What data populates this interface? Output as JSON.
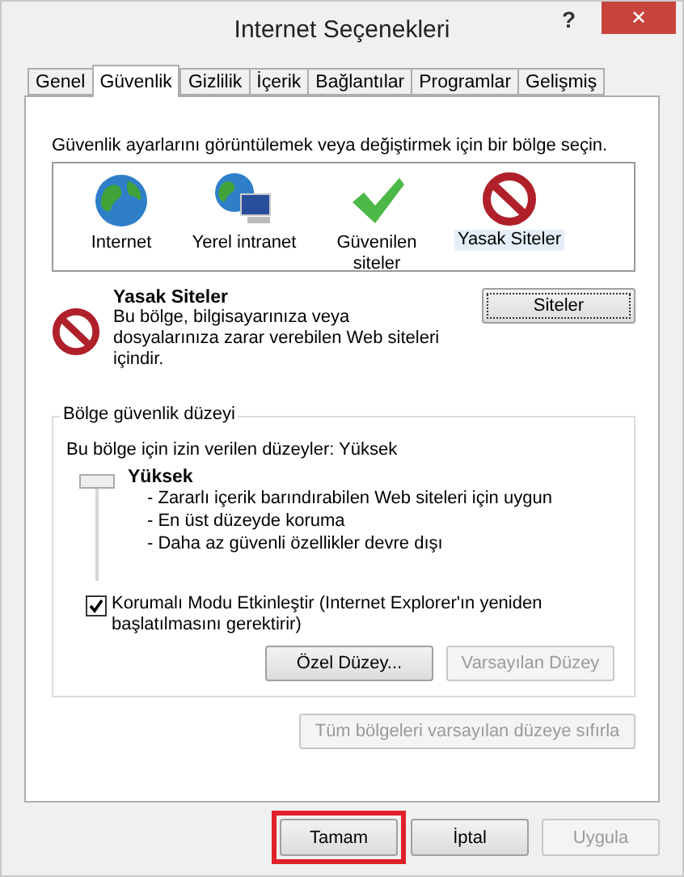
{
  "window": {
    "title": "Internet Seçenekleri",
    "help": "?",
    "close": "✕"
  },
  "tabs": [
    {
      "label": "Genel",
      "selected": false
    },
    {
      "label": "Güvenlik",
      "selected": true
    },
    {
      "label": "Gizlilik",
      "selected": false
    },
    {
      "label": "İçerik",
      "selected": false
    },
    {
      "label": "Bağlantılar",
      "selected": false
    },
    {
      "label": "Programlar",
      "selected": false
    },
    {
      "label": "Gelişmiş",
      "selected": false
    }
  ],
  "intro": "Güvenlik ayarlarını görüntülemek veya değiştirmek için bir bölge seçin.",
  "zones": [
    {
      "kind": "globe",
      "label": "Internet",
      "selected": false
    },
    {
      "kind": "network",
      "label": "Yerel intranet",
      "selected": false
    },
    {
      "kind": "check",
      "label": "Güvenilen siteler",
      "selected": false
    },
    {
      "kind": "blocked",
      "label": "Yasak Siteler",
      "selected": true
    }
  ],
  "zone_detail": {
    "kind": "blocked",
    "title": "Yasak Siteler",
    "description": "Bu bölge, bilgisayarınıza veya dosyalarınıza zarar verebilen Web siteleri içindir.",
    "button": {
      "label": "Siteler"
    }
  },
  "security_level": {
    "legend": "Bölge güvenlik düzeyi",
    "allowed": "Bu bölge için izin verilen düzeyler: Yüksek",
    "level": 1,
    "name": "Yüksek",
    "points": [
      "- Zararlı içerik barındırabilen Web siteleri için uygun",
      "- En üst düzeyde koruma",
      "- Daha az güvenli özellikler devre dışı"
    ],
    "protected_mode": {
      "label": "Korumalı Modu Etkinleştir (Internet Explorer'ın yeniden başlatılmasını gerektirir)",
      "checked": true
    },
    "buttons": [
      {
        "label": "Özel Düzey...",
        "disabled": false
      },
      {
        "label": "Varsayılan Düzey",
        "disabled": true
      }
    ]
  },
  "reset_button": {
    "label": "Tüm bölgeleri varsayılan düzeye sıfırla",
    "disabled": true
  },
  "footer_buttons": [
    {
      "label": "Tamam",
      "disabled": false,
      "highlighted": true
    },
    {
      "label": "İptal",
      "disabled": false,
      "highlighted": false
    },
    {
      "label": "Uygula",
      "disabled": true,
      "highlighted": false
    }
  ]
}
